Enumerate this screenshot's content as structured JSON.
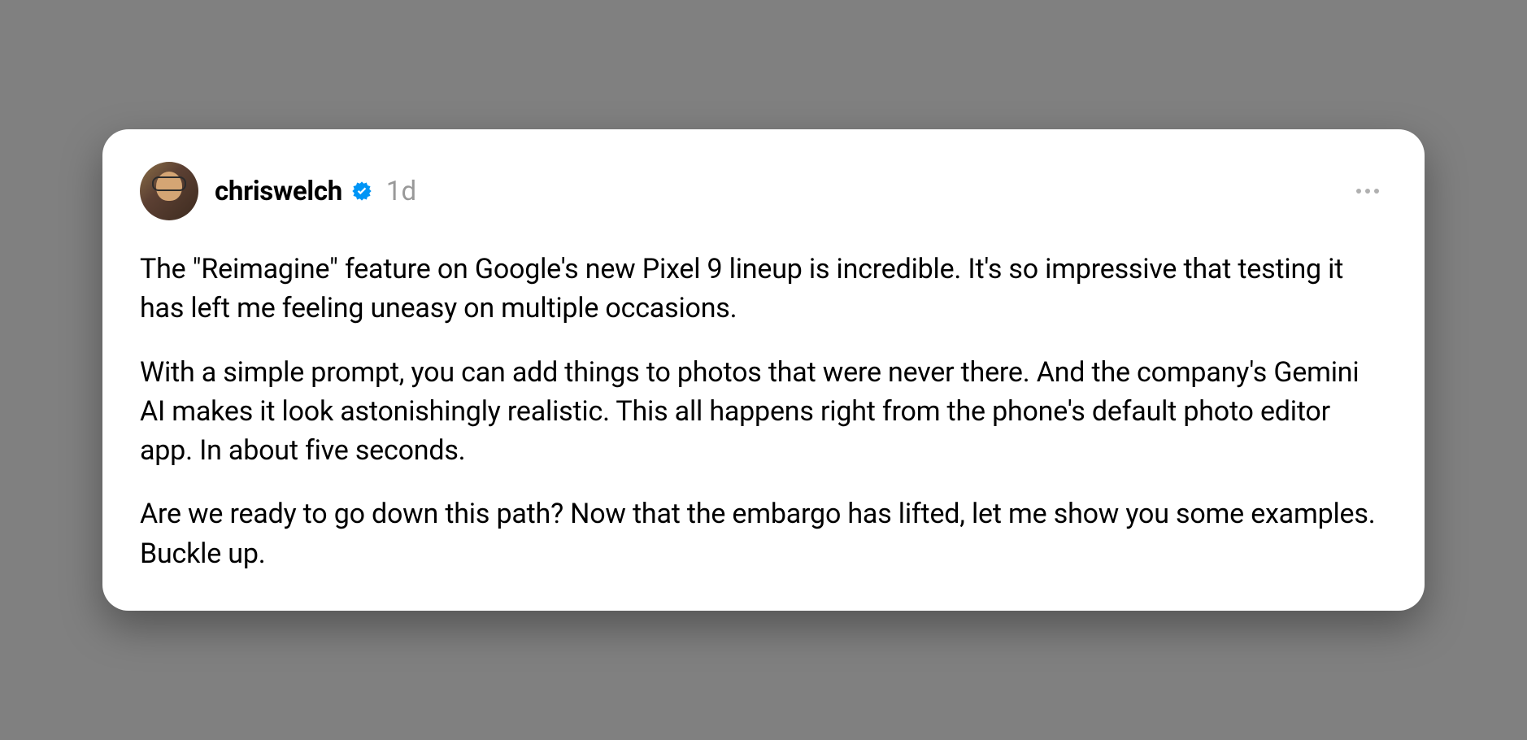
{
  "post": {
    "author": {
      "username": "chriswelch",
      "verified": true
    },
    "timestamp": "1d",
    "paragraphs": [
      "The \"Reimagine\" feature on Google's new Pixel 9 lineup is incredible. It's so impressive that testing it has left me feeling uneasy on multiple occasions.",
      "With a simple prompt, you can add things to photos that were never there. And the company's Gemini AI makes it look astonishingly realistic. This all happens right from the phone's default photo editor app. In about five seconds.",
      "Are we ready to go down this path? Now that the embargo has lifted, let me show you some examples. Buckle up."
    ]
  },
  "colors": {
    "verified_badge": "#0095F6"
  }
}
